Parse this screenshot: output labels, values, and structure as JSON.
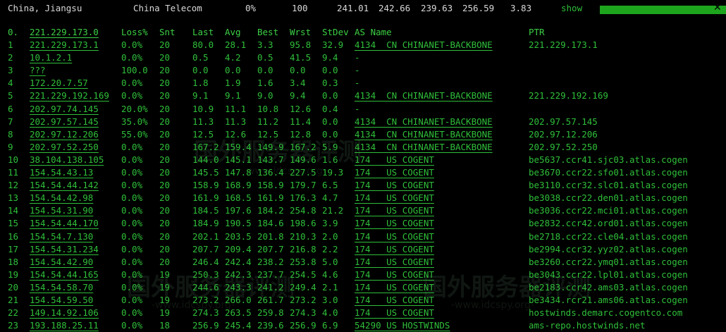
{
  "watermark": {
    "brand": "国外服务器评测",
    "url": "-www.idcspy.org-"
  },
  "summary": {
    "location": "China, Jiangsu",
    "isp": "China Telecom",
    "loss": "0%",
    "snt": "100",
    "last": "241.01",
    "avg": "242.66",
    "best": "239.63",
    "wrst": "256.59",
    "stdev": "3.83",
    "show_label": "show",
    "progress_fraction": 1.0,
    "progress_color": "#1ea51e"
  },
  "table": {
    "headers": [
      "0.",
      "221.229.173.0",
      "Loss%",
      "Snt",
      "Last",
      "Avg",
      "Best",
      "Wrst",
      "StDev",
      "AS Name",
      "PTR"
    ],
    "rows": [
      {
        "hop": "1",
        "ip": "221.229.173.1",
        "loss": "0.0%",
        "snt": "20",
        "last": "80.0",
        "avg": "28.1",
        "best": "3.3",
        "wrst": "95.8",
        "stdev": "32.9",
        "as": "4134  CN CHINANET-BACKBONE",
        "ptr": "221.229.173.1"
      },
      {
        "hop": "2",
        "ip": "10.1.2.1",
        "loss": "0.0%",
        "snt": "20",
        "last": "0.5",
        "avg": "4.2",
        "best": "0.5",
        "wrst": "41.5",
        "stdev": "9.4",
        "as": "-",
        "ptr": ""
      },
      {
        "hop": "3",
        "ip": "???",
        "loss": "100.0",
        "snt": "20",
        "last": "0.0",
        "avg": "0.0",
        "best": "0.0",
        "wrst": "0.0",
        "stdev": "0.0",
        "as": "-",
        "ptr": ""
      },
      {
        "hop": "4",
        "ip": "172.20.7.57",
        "loss": "0.0%",
        "snt": "20",
        "last": "1.8",
        "avg": "1.9",
        "best": "1.6",
        "wrst": "3.4",
        "stdev": "0.3",
        "as": "-",
        "ptr": ""
      },
      {
        "hop": "5",
        "ip": "221.229.192.169",
        "loss": "0.0%",
        "snt": "20",
        "last": "9.1",
        "avg": "9.1",
        "best": "9.0",
        "wrst": "9.4",
        "stdev": "0.0",
        "as": "4134  CN CHINANET-BACKBONE",
        "ptr": "221.229.192.169"
      },
      {
        "hop": "6",
        "ip": "202.97.74.145",
        "loss": "20.0%",
        "snt": "20",
        "last": "10.9",
        "avg": "11.1",
        "best": "10.8",
        "wrst": "12.6",
        "stdev": "0.4",
        "as": "-",
        "ptr": ""
      },
      {
        "hop": "7",
        "ip": "202.97.57.145",
        "loss": "35.0%",
        "snt": "20",
        "last": "11.3",
        "avg": "11.3",
        "best": "11.2",
        "wrst": "11.4",
        "stdev": "0.0",
        "as": "4134  CN CHINANET-BACKBONE",
        "ptr": "202.97.57.145"
      },
      {
        "hop": "8",
        "ip": "202.97.12.206",
        "loss": "55.0%",
        "snt": "20",
        "last": "12.5",
        "avg": "12.6",
        "best": "12.5",
        "wrst": "12.8",
        "stdev": "0.0",
        "as": "4134  CN CHINANET-BACKBONE",
        "ptr": "202.97.12.206"
      },
      {
        "hop": "9",
        "ip": "202.97.52.250",
        "loss": "0.0%",
        "snt": "20",
        "last": "167.2",
        "avg": "159.4",
        "best": "149.9",
        "wrst": "167.2",
        "stdev": "5.9",
        "as": "4134  CN CHINANET-BACKBONE",
        "ptr": "202.97.52.250"
      },
      {
        "hop": "10",
        "ip": "38.104.138.105",
        "loss": "0.0%",
        "snt": "20",
        "last": "144.0",
        "avg": "145.1",
        "best": "143.7",
        "wrst": "149.6",
        "stdev": "1.6",
        "as": "174   US COGENT",
        "ptr": "be5637.ccr41.sjc03.atlas.cogen"
      },
      {
        "hop": "11",
        "ip": "154.54.43.13",
        "loss": "0.0%",
        "snt": "20",
        "last": "145.5",
        "avg": "147.8",
        "best": "136.4",
        "wrst": "227.5",
        "stdev": "19.3",
        "as": "174   US COGENT",
        "ptr": "be3670.ccr22.sfo01.atlas.cogen"
      },
      {
        "hop": "12",
        "ip": "154.54.44.142",
        "loss": "0.0%",
        "snt": "20",
        "last": "158.9",
        "avg": "168.9",
        "best": "158.9",
        "wrst": "179.7",
        "stdev": "6.5",
        "as": "174   US COGENT",
        "ptr": "be3110.ccr32.slc01.atlas.cogen"
      },
      {
        "hop": "13",
        "ip": "154.54.42.98",
        "loss": "0.0%",
        "snt": "20",
        "last": "161.9",
        "avg": "168.5",
        "best": "161.9",
        "wrst": "176.3",
        "stdev": "4.7",
        "as": "174   US COGENT",
        "ptr": "be3038.ccr22.den01.atlas.cogen"
      },
      {
        "hop": "14",
        "ip": "154.54.31.90",
        "loss": "0.0%",
        "snt": "20",
        "last": "184.5",
        "avg": "197.6",
        "best": "184.2",
        "wrst": "254.8",
        "stdev": "21.2",
        "as": "174   US COGENT",
        "ptr": "be3036.ccr22.mci01.atlas.cogen"
      },
      {
        "hop": "15",
        "ip": "154.54.44.170",
        "loss": "0.0%",
        "snt": "20",
        "last": "184.9",
        "avg": "190.5",
        "best": "184.6",
        "wrst": "198.6",
        "stdev": "3.9",
        "as": "174   US COGENT",
        "ptr": "be2832.ccr42.ord01.atlas.cogen"
      },
      {
        "hop": "16",
        "ip": "154.54.7.130",
        "loss": "0.0%",
        "snt": "20",
        "last": "202.1",
        "avg": "203.5",
        "best": "201.8",
        "wrst": "210.3",
        "stdev": "2.0",
        "as": "174   US COGENT",
        "ptr": "be2718.ccr22.cle04.atlas.cogen"
      },
      {
        "hop": "17",
        "ip": "154.54.31.234",
        "loss": "0.0%",
        "snt": "20",
        "last": "207.7",
        "avg": "209.4",
        "best": "207.7",
        "wrst": "216.8",
        "stdev": "2.2",
        "as": "174   US COGENT",
        "ptr": "be2994.ccr32.yyz02.atlas.cogen"
      },
      {
        "hop": "18",
        "ip": "154.54.42.90",
        "loss": "0.0%",
        "snt": "20",
        "last": "246.4",
        "avg": "242.4",
        "best": "238.2",
        "wrst": "253.8",
        "stdev": "5.0",
        "as": "174   US COGENT",
        "ptr": "be3260.ccr22.ymq01.atlas.cogen"
      },
      {
        "hop": "19",
        "ip": "154.54.44.165",
        "loss": "0.0%",
        "snt": "19",
        "last": "250.3",
        "avg": "242.3",
        "best": "237.7",
        "wrst": "254.5",
        "stdev": "4.6",
        "as": "174   US COGENT",
        "ptr": "be3043.ccr22.lpl01.atlas.cogen"
      },
      {
        "hop": "20",
        "ip": "154.54.58.70",
        "loss": "0.0%",
        "snt": "19",
        "last": "244.6",
        "avg": "243.3",
        "best": "241.2",
        "wrst": "249.4",
        "stdev": "2.1",
        "as": "174   US COGENT",
        "ptr": "be2183.ccr42.ams03.atlas.cogen"
      },
      {
        "hop": "21",
        "ip": "154.54.59.50",
        "loss": "0.0%",
        "snt": "19",
        "last": "273.2",
        "avg": "266.0",
        "best": "261.7",
        "wrst": "273.2",
        "stdev": "3.0",
        "as": "174   US COGENT",
        "ptr": "be3434.rcr21.ams06.atlas.cogen"
      },
      {
        "hop": "22",
        "ip": "149.14.92.106",
        "loss": "0.0%",
        "snt": "19",
        "last": "274.3",
        "avg": "263.5",
        "best": "259.8",
        "wrst": "274.3",
        "stdev": "4.0",
        "as": "174   US COGENT",
        "ptr": "hostwinds.demarc.cogentco.com"
      },
      {
        "hop": "23",
        "ip": "193.188.25.11",
        "loss": "0.0%",
        "snt": "18",
        "last": "256.9",
        "avg": "245.4",
        "best": "239.6",
        "wrst": "256.9",
        "stdev": "6.9",
        "as": "54290 US HOSTWINDS",
        "ptr": "ams-repo.hostwinds.net"
      }
    ]
  }
}
